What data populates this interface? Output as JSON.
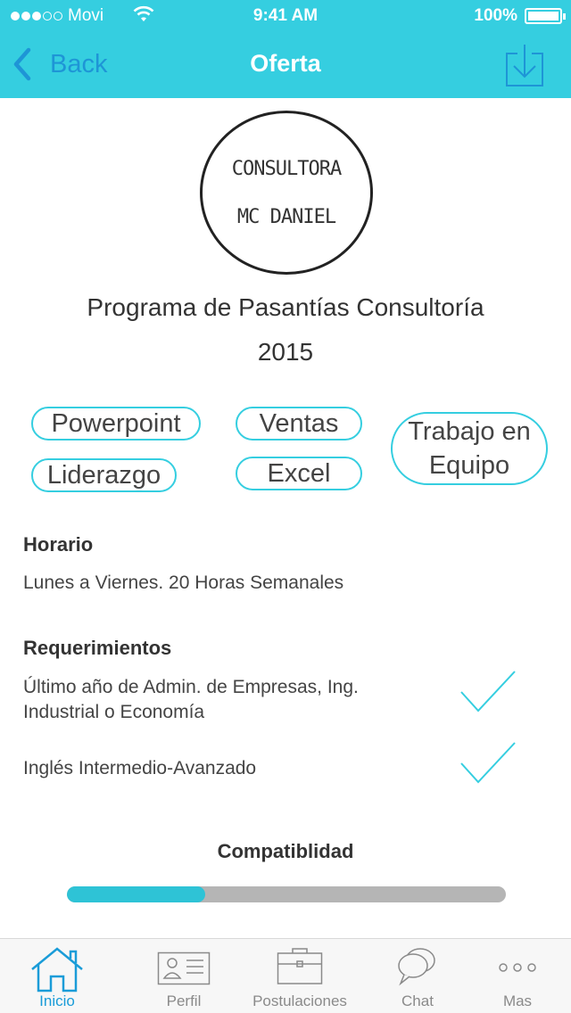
{
  "status": {
    "carrier": "Movi",
    "time": "9:41 AM",
    "battery": "100%"
  },
  "nav": {
    "back_label": "Back",
    "title": "Oferta",
    "download_icon": "download-icon"
  },
  "logo": {
    "line1": "CONSULTORA",
    "line2": "MC DANIEL"
  },
  "program": {
    "title_line1": "Programa de Pasantías Consultoría",
    "title_line2": "2015"
  },
  "tags": {
    "t1": "Powerpoint",
    "t2": "Ventas",
    "t3_line1": "Trabajo en",
    "t3_line2": "Equipo",
    "t4": "Liderazgo",
    "t5": "Excel"
  },
  "horario": {
    "title": "Horario",
    "text": "Lunes a Viernes. 20 Horas Semanales"
  },
  "requerimientos": {
    "title": "Requerimientos",
    "items": [
      {
        "line1": "Último año de Admin. de Empresas, Ing.",
        "line2": "Industrial o Economía",
        "status": "check-icon"
      },
      {
        "line1": "Inglés Intermedio-Avanzado",
        "status": "check-icon"
      }
    ]
  },
  "compatibilidad": {
    "title": "Compatiblidad",
    "progress": 0.315
  },
  "tabbar": {
    "items": [
      {
        "label": "Inicio",
        "icon": "home-icon",
        "active": true
      },
      {
        "label": "Perfil",
        "icon": "profile-card-icon",
        "active": false
      },
      {
        "label": "Postulaciones",
        "icon": "briefcase-icon",
        "active": false
      },
      {
        "label": "Chat",
        "icon": "chat-icon",
        "active": false
      },
      {
        "label": "Mas",
        "icon": "more-icon",
        "active": false
      }
    ]
  },
  "colors": {
    "accent": "#35cee0",
    "link": "#1a9cd8",
    "progress_bg": "#b5b5b5"
  }
}
